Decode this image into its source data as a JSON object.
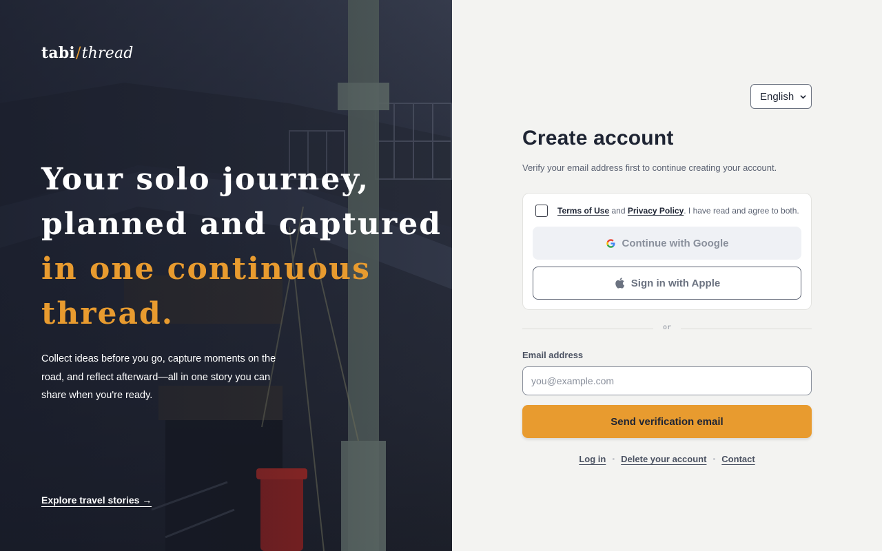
{
  "brand": {
    "part1": "tabi",
    "slash": "/",
    "part2": "thread"
  },
  "hero": {
    "headline_line1": "Your solo journey,",
    "headline_line2": "planned and captured",
    "headline_line3": "in one continuous",
    "headline_line4": "thread.",
    "lede": "Collect ideas before you go, capture moments on the road, and reflect afterward—all in one story you can share when you're ready.",
    "explore_link": "Explore travel stories →"
  },
  "language_select": {
    "value": "English"
  },
  "form": {
    "title": "Create account",
    "subtitle": "Verify your email address first to continue creating your account.",
    "terms": {
      "terms_link": "Terms of Use",
      "and": "and",
      "privacy_link": "Privacy Policy",
      "suffix": ". I have read and agree to both."
    },
    "google_button": "Continue with Google",
    "apple_button": "Sign in with Apple",
    "divider_text": "or",
    "email_label": "Email address",
    "email_placeholder": "you@example.com",
    "email_value": "",
    "send_button": "Send verification email"
  },
  "footer": {
    "login": "Log in",
    "delete_account": "Delete your account",
    "contact": "Contact"
  },
  "colors": {
    "accent": "#e89b2f",
    "ink": "#1e2433",
    "muted": "#5b6272",
    "panel_bg": "#f3f3f1"
  }
}
